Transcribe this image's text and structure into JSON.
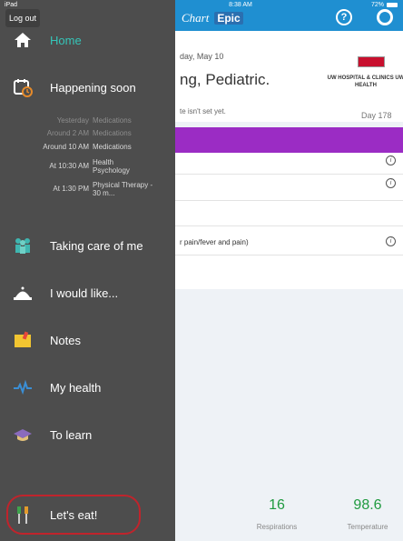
{
  "main": {
    "status_time": "8:38 AM",
    "battery": "72%",
    "brand": {
      "mychart": "Chart",
      "epic": "Epic"
    },
    "header": {
      "date": "day, May 10",
      "greeting": "ng, Pediatric.",
      "not_set": "te isn't set yet.",
      "hospital": "UW HOSPITAL & CLINICS UW HEALTH",
      "day": "Day 178"
    },
    "rows": [
      {
        "text": ""
      },
      {
        "text": ""
      },
      {
        "text": "r pain/fever and pain)"
      }
    ],
    "vitals": [
      {
        "value": "16",
        "label": "Respirations"
      },
      {
        "value": "98.6",
        "label": "Temperature"
      }
    ],
    "colors": {
      "accent": "#1f8fd1",
      "purple": "#9b2cc4",
      "vital": "#1f9a3f"
    }
  },
  "drawer": {
    "status": "iPad",
    "logout": "Log out",
    "items": [
      {
        "label": "Home",
        "icon": "home-icon"
      },
      {
        "label": "Happening soon",
        "icon": "calendar-clock-icon"
      },
      {
        "label": "Taking care of me",
        "icon": "care-team-icon"
      },
      {
        "label": "I would like...",
        "icon": "service-bell-icon"
      },
      {
        "label": "Notes",
        "icon": "notes-icon"
      },
      {
        "label": "My health",
        "icon": "heartbeat-icon"
      },
      {
        "label": "To learn",
        "icon": "graduation-cap-icon"
      },
      {
        "label": "Let's eat!",
        "icon": "fork-knife-icon"
      }
    ],
    "schedule": [
      {
        "time": "Yesterday",
        "what": "Medications"
      },
      {
        "time": "Around 2 AM",
        "what": "Medications"
      },
      {
        "time": "Around 10 AM",
        "what": "Medications"
      },
      {
        "time": "At 10:30 AM",
        "what": "Health Psychology"
      },
      {
        "time": "At 1:30 PM",
        "what": "Physical Therapy - 30 m..."
      }
    ],
    "active_color": "#35c6b9",
    "highlight_color": "#c0242c"
  }
}
